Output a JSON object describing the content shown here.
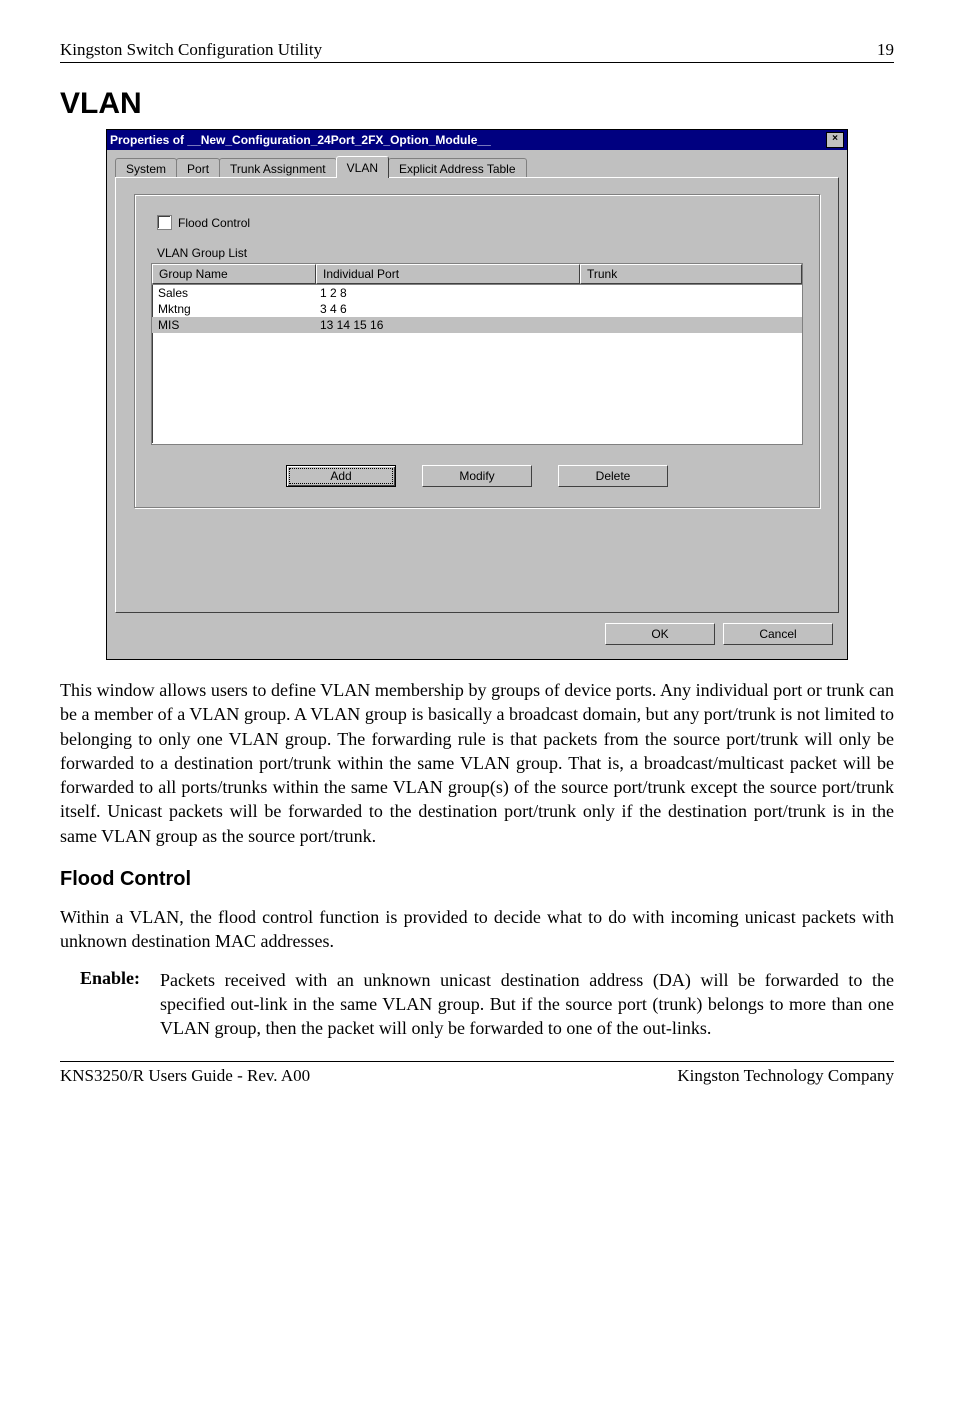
{
  "header": {
    "title": "Kingston Switch Configuration Utility",
    "page_number": "19"
  },
  "section_heading": "VLAN",
  "dialog": {
    "title": "Properties of __New_Configuration_24Port_2FX_Option_Module__",
    "close_glyph": "×",
    "tabs": {
      "system": "System",
      "port": "Port",
      "trunk_assignment": "Trunk Assignment",
      "vlan": "VLAN",
      "explicit_address_table": "Explicit Address Table"
    },
    "flood_control_label": "Flood Control",
    "vlan_group_list_label": "VLAN Group List",
    "columns": {
      "group_name": "Group Name",
      "individual_port": "Individual Port",
      "trunk": "Trunk"
    },
    "rows": [
      {
        "group_name": "Sales",
        "individual_port": "1 2 8",
        "trunk": ""
      },
      {
        "group_name": "Mktng",
        "individual_port": "3 4 6",
        "trunk": ""
      },
      {
        "group_name": "MIS",
        "individual_port": "13 14 15 16",
        "trunk": ""
      }
    ],
    "buttons": {
      "add": "Add",
      "modify": "Modify",
      "delete": "Delete",
      "ok": "OK",
      "cancel": "Cancel"
    }
  },
  "paragraph_main": "This window allows users to define VLAN membership by groups of device ports. Any individual port or trunk can be a member of a VLAN group. A VLAN group is basically a broadcast domain, but any port/trunk is not limited to belonging to only one VLAN group. The forwarding rule is that packets from the source port/trunk will only be forwarded to a destination port/trunk within the same VLAN group. That is, a broadcast/multicast packet will be forwarded to all ports/trunks within the same VLAN group(s) of the source port/trunk except the source port/trunk itself. Unicast packets will be forwarded to the destination port/trunk only if the destination port/trunk is in the same VLAN group as the source port/trunk.",
  "flood_control_heading": "Flood Control",
  "flood_control_intro": "Within a VLAN, the flood control function is provided to decide what to do with incoming unicast packets with unknown destination MAC addresses.",
  "enable_term": "Enable:",
  "enable_text": "Packets received with an unknown unicast destination address (DA) will be forwarded to the specified out-link in the same VLAN group. But if the source port (trunk) belongs to more than one VLAN group, then the packet will only be forwarded to one of the out-links.",
  "footer": {
    "left": "KNS3250/R Users Guide - Rev. A00",
    "right": "Kingston Technology Company"
  }
}
